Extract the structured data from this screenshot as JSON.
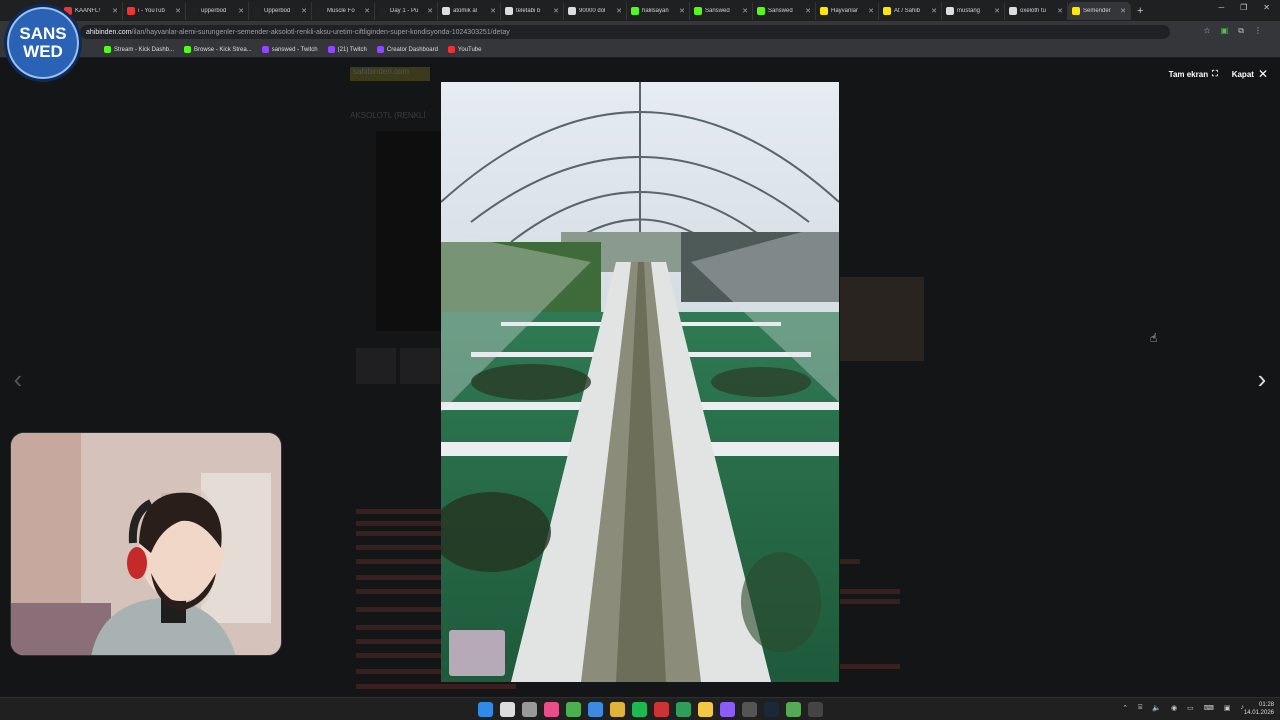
{
  "brand": {
    "line1": "SANS",
    "line2": "WED"
  },
  "tabs": [
    {
      "label": "KAANFL!",
      "color": "#e33"
    },
    {
      "label": "i - YouTub",
      "color": "#e33"
    },
    {
      "label": "upperbod",
      "color": "#222"
    },
    {
      "label": "Upperbod",
      "color": "#222"
    },
    {
      "label": "Muscle Fo",
      "color": "#222"
    },
    {
      "label": "Day 1 - Pu",
      "color": "#222"
    },
    {
      "label": "atomik al",
      "color": "#ddd"
    },
    {
      "label": "teletabi b",
      "color": "#ddd"
    },
    {
      "label": "90000 dol",
      "color": "#ddd"
    },
    {
      "label": "halilsayan",
      "color": "#53fc18"
    },
    {
      "label": "Sanswed",
      "color": "#53fc18"
    },
    {
      "label": "Sanswed",
      "color": "#53fc18"
    },
    {
      "label": "Hayvanlar",
      "color": "#ffe800"
    },
    {
      "label": "At / Sahib",
      "color": "#ffe800"
    },
    {
      "label": "mustang",
      "color": "#ddd"
    },
    {
      "label": "oxeloth tu",
      "color": "#ddd"
    },
    {
      "label": "Semender",
      "color": "#ffe800",
      "active": true
    }
  ],
  "address": {
    "host": "ahibinden.com",
    "path": "/ilan/hayvanlar-alemi-surungenler-semender-aksolotl-renkli-aksu-uretim-ciftliginden-super-kondisyonda-1024303251/detay"
  },
  "bookmarks": [
    {
      "label": "Stream - Kick Dashb...",
      "color": "#53fc18"
    },
    {
      "label": "Browse - Kick Strea...",
      "color": "#53fc18"
    },
    {
      "label": "sanswed - Twitch",
      "color": "#9146ff"
    },
    {
      "label": "(21) Twitch",
      "color": "#9146ff"
    },
    {
      "label": "Creator Dashboard",
      "color": "#9146ff"
    },
    {
      "label": "YouTube",
      "color": "#e33"
    }
  ],
  "lightbox": {
    "fullscreen_label": "Tam ekran",
    "close_label": "Kapat"
  },
  "page_bg": {
    "title": "AKSOLOTL (RENKLİ",
    "logo": "sahibinden.com"
  },
  "clock": {
    "time": "01:28",
    "date": "14.01.2026"
  }
}
